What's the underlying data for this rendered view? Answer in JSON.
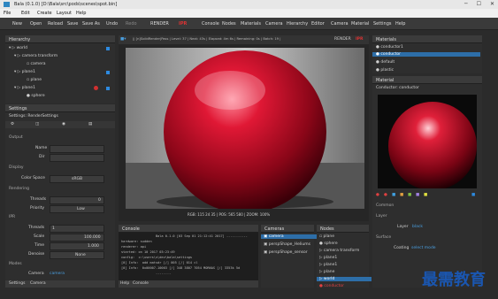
{
  "window": {
    "title": "Bala (0.1.0) [D:\\Bala\\src\\pods\\scenes\\spot.bin]"
  },
  "menu": [
    "File",
    "Edit",
    "Create",
    "Layout",
    "Help"
  ],
  "toolbar": {
    "left": [
      "New",
      "Open",
      "Reload",
      "Save",
      "Save As",
      "Undo",
      "Redo",
      "RENDER"
    ],
    "tabs": [
      "Console",
      "Nodes",
      "Materials",
      "Camera",
      "Hierarchy",
      "Editor",
      "Camera",
      "Material",
      "Settings",
      "Help"
    ]
  },
  "hierarchy": {
    "title": "Hierarchy",
    "items": [
      "world",
      "camera transform",
      "camera",
      "plane1",
      "plane",
      "plane1",
      "sphere"
    ]
  },
  "settings": {
    "title": "Settings",
    "header": "Settings: RenderSettings",
    "sections": {
      "output": "Output",
      "display": "Display",
      "rendering": "Rendering",
      "ipr": "IPR",
      "modes": "Modes"
    },
    "fields": [
      {
        "label": "Name",
        "value": ""
      },
      {
        "label": "Dir",
        "value": ""
      },
      {
        "label": "Color Space",
        "value": "sRGB"
      },
      {
        "label": "Threads",
        "value": "0"
      },
      {
        "label": "Priority",
        "value": "Low"
      },
      {
        "label": "Threads",
        "value": "1"
      },
      {
        "label": "Scale",
        "value": "100.000"
      },
      {
        "label": "Time",
        "value": "1.000"
      },
      {
        "label": "Denoise",
        "value": "None"
      },
      {
        "label": "Camera",
        "value": "camera"
      }
    ],
    "footer_tabs": [
      "Settings",
      "Camera"
    ]
  },
  "viewport": {
    "status": "|| [n]SolidRender|Pass | Level: 37 | Next: 43s | Elapsed: 4m 6s | Remaining: 0s | Batch: 19 |",
    "render_label": "RENDER",
    "footer": "RGB: 115  24  35  |  POS: 565  580  |  ZOOM: 100%"
  },
  "materials": {
    "title": "Materials",
    "items": [
      "conductor1",
      "conductor",
      "default",
      "plastic"
    ]
  },
  "material": {
    "title": "Material",
    "header": "Conductor: conductor",
    "sections": [
      "Common",
      "Layer",
      "Surface"
    ],
    "layer_label": "Layer",
    "layer_value": "black",
    "coating_label": "Coating",
    "coating_value": "select mode"
  },
  "console": {
    "title": "Console",
    "lines": [
      "                  Bala 0.1.0 [03 Sep 01 21:12:41 2017] -----------",
      "hardware: sudden",
      "renderer: api",
      "started: on 10 2017 03:23:49",
      "config:  c:\\users\\s\\dev\\bala\\settings",
      "[0] Info:  add matsdr [/] 005 [/] 014 cl",
      "[0] Info:  0x00007-10003 [/] 348 3807 7054 MORNAS [/] 3353k 5d",
      "                  --------"
    ],
    "footer_tabs": [
      "Help",
      "Console"
    ]
  },
  "cameras": {
    "title": "Cameras",
    "items": [
      "camera",
      "perspShape_Heliums",
      "perspShape_sensor"
    ]
  },
  "nodes": {
    "title": "Nodes",
    "items": [
      "plane",
      "sphere",
      "camera transform",
      "plane1",
      "plane1",
      "plane",
      "world",
      "conductor"
    ]
  },
  "watermark": "最需教育",
  "colors": {
    "accent": "#2d6ea8",
    "render_red": "#c0122a"
  }
}
